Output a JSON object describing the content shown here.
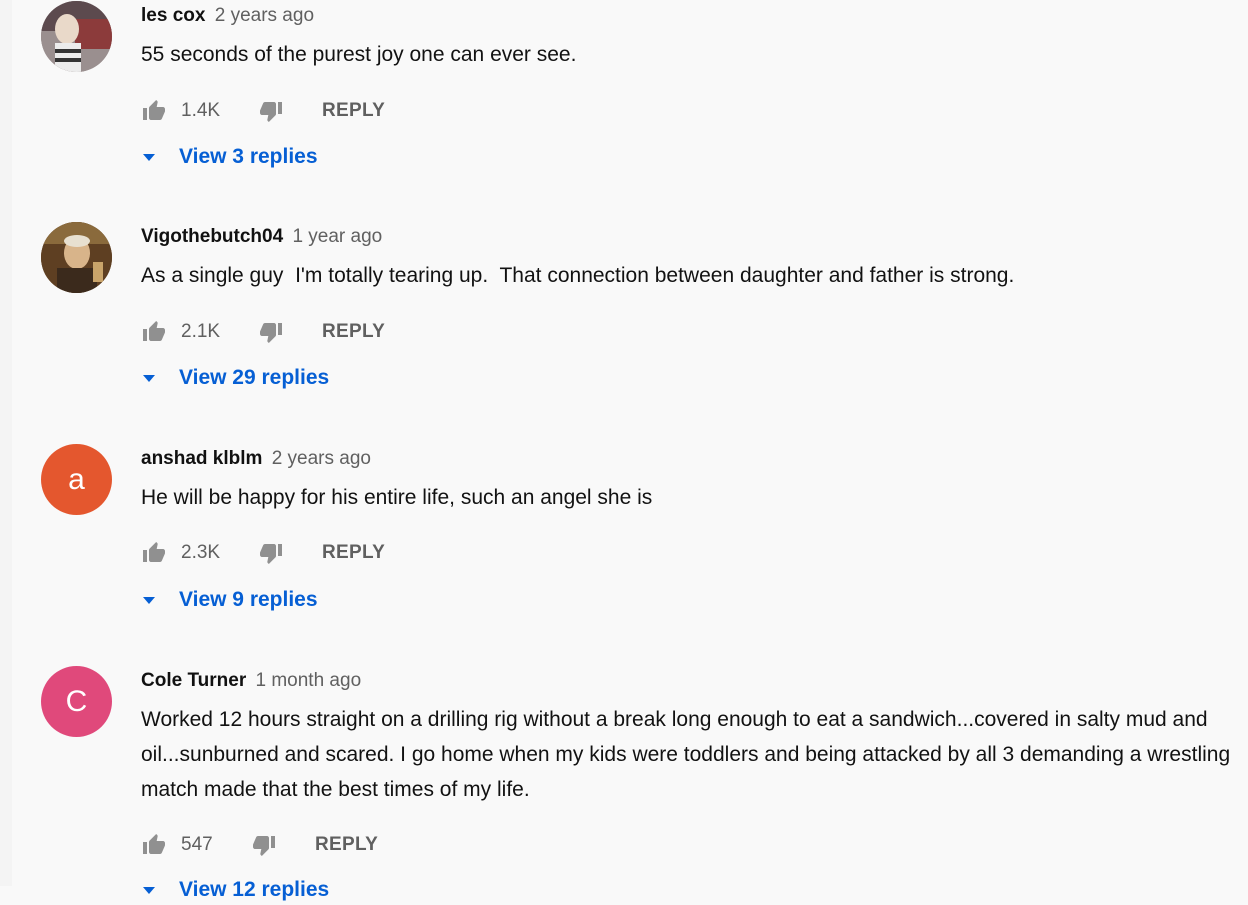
{
  "comments": [
    {
      "author": "les cox",
      "time": "2 years ago",
      "text": "55 seconds of the purest joy one can ever see.",
      "likes": "1.4K",
      "reply": "REPLY",
      "replies": "View 3 replies",
      "avatar": {
        "type": "photo",
        "color": "#7a6a6a"
      }
    },
    {
      "author": "Vigothebutch04",
      "time": "1 year ago",
      "text": "As a single guy  I'm totally tearing up.  That connection between daughter and father is strong.",
      "likes": "2.1K",
      "reply": "REPLY",
      "replies": "View 29 replies",
      "avatar": {
        "type": "photo",
        "color": "#6b4a2a"
      }
    },
    {
      "author": "anshad klblm",
      "time": "2 years ago",
      "text": "He will be happy for his entire life, such an angel she is",
      "likes": "2.3K",
      "reply": "REPLY",
      "replies": "View 9 replies",
      "avatar": {
        "type": "letter",
        "letter": "a",
        "color": "#e4572e"
      }
    },
    {
      "author": "Cole Turner",
      "time": "1 month ago",
      "text": "Worked 12 hours straight on a drilling rig without a break long enough to eat a sandwich...covered in salty mud and oil...sunburned and scared. I go home when my kids were toddlers and being attacked by all 3 demanding a wrestling match made that the best times of my life.",
      "likes": "547",
      "reply": "REPLY",
      "replies": "View 12 replies",
      "avatar": {
        "type": "letter",
        "letter": "C",
        "color": "#e0497b"
      }
    }
  ],
  "icons": {
    "like": "thumb-up-icon",
    "dislike": "thumb-down-icon",
    "expand": "triangle-down-icon"
  },
  "colors": {
    "link": "#065fd4",
    "muted": "#606060",
    "background": "#f9f9f9"
  }
}
